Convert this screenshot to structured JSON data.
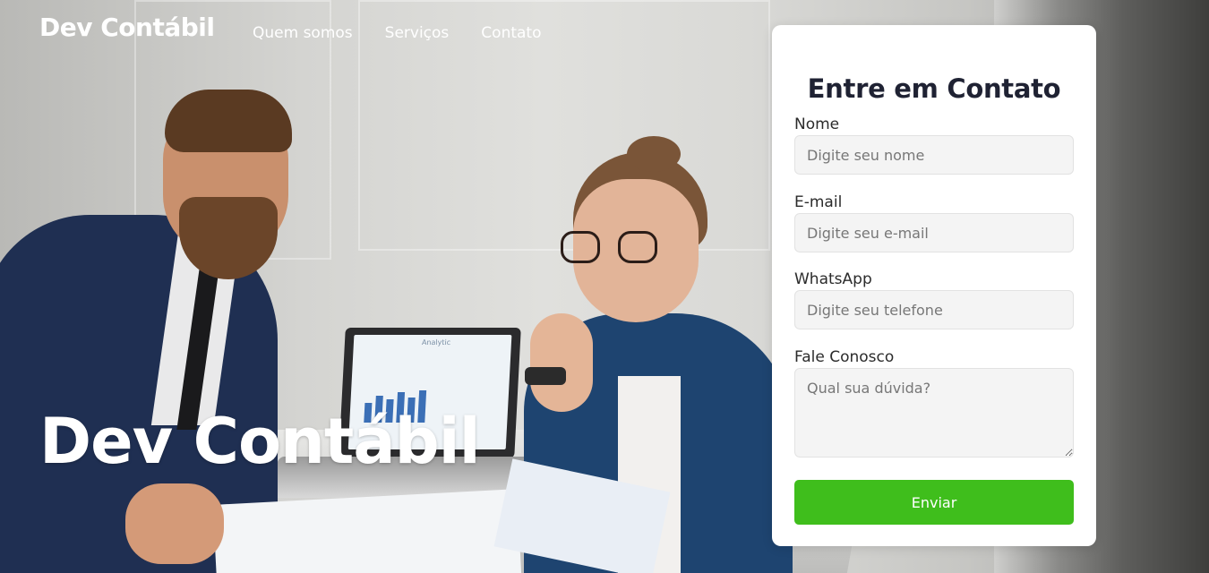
{
  "header": {
    "logo": "Dev Contábil",
    "nav": [
      {
        "label": "Quem somos"
      },
      {
        "label": "Serviços"
      },
      {
        "label": "Contato"
      }
    ]
  },
  "hero": {
    "title": "Dev Contábil",
    "laptop_screen_text": "Analytic"
  },
  "contact_form": {
    "title": "Entre em Contato",
    "fields": {
      "name": {
        "label": "Nome",
        "placeholder": "Digite seu nome",
        "value": ""
      },
      "email": {
        "label": "E-mail",
        "placeholder": "Digite seu e-mail",
        "value": ""
      },
      "whatsapp": {
        "label": "WhatsApp",
        "placeholder": "Digite seu telefone",
        "value": ""
      },
      "message": {
        "label": "Fale Conosco",
        "placeholder": "Qual sua dúvida?",
        "value": ""
      }
    },
    "submit_label": "Enviar"
  },
  "colors": {
    "accent_button": "#3fbe1c",
    "card_title": "#1f2233",
    "nav_text": "#ffffff",
    "card_background": "#ffffff"
  }
}
